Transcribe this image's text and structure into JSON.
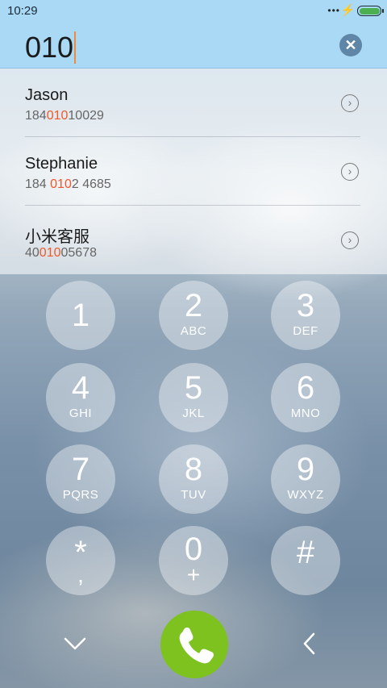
{
  "status": {
    "time": "10:29",
    "battery_percent": 100,
    "battery_color": "#4caf50"
  },
  "search": {
    "value": "010"
  },
  "results": [
    {
      "name": "Jason",
      "number_parts": [
        "184",
        "010",
        "10029"
      ]
    },
    {
      "name": "Stephanie",
      "number_parts": [
        "184 ",
        "010",
        "2 4685"
      ]
    },
    {
      "name": "小米客服",
      "number_parts": [
        "40",
        "010",
        "05678"
      ]
    }
  ],
  "keypad": [
    {
      "digit": "1",
      "letters": ""
    },
    {
      "digit": "2",
      "letters": "ABC"
    },
    {
      "digit": "3",
      "letters": "DEF"
    },
    {
      "digit": "4",
      "letters": "GHI"
    },
    {
      "digit": "5",
      "letters": "JKL"
    },
    {
      "digit": "6",
      "letters": "MNO"
    },
    {
      "digit": "7",
      "letters": "PQRS"
    },
    {
      "digit": "8",
      "letters": "TUV"
    },
    {
      "digit": "9",
      "letters": "WXYZ"
    },
    {
      "digit": "*",
      "letters": ","
    },
    {
      "digit": "0",
      "letters": "+"
    },
    {
      "digit": "#",
      "letters": ""
    }
  ],
  "colors": {
    "highlight": "#f0582a",
    "call_button": "#7dc21e",
    "search_bar": "#a9d9f5",
    "caret": "#f08a3c"
  },
  "icons": {
    "clear": "close-circle-icon",
    "detail": "chevron-right-circle-icon",
    "collapse": "chevron-down-icon",
    "call": "phone-icon",
    "back": "chevron-left-icon"
  }
}
